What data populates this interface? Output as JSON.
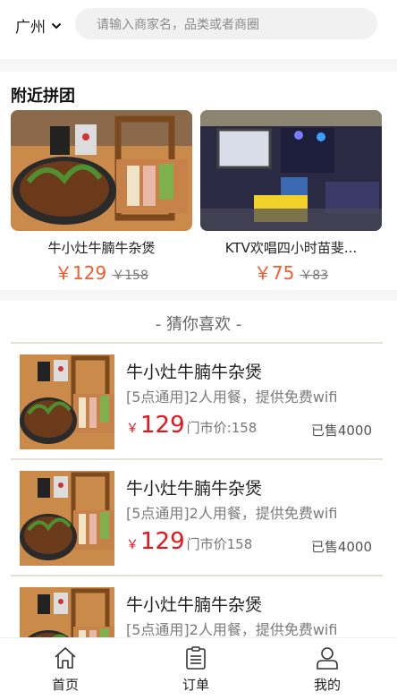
{
  "header": {
    "city": "广州",
    "search_placeholder": "请输入商家名，品类或者商圈"
  },
  "nearby": {
    "title": "附近拼团",
    "deals": [
      {
        "name": "牛小灶牛腩牛杂煲",
        "price": "￥129",
        "old_price": "￥158"
      },
      {
        "name": "KTV欢唱四小时苗斐...",
        "price": "￥75",
        "old_price": "￥83"
      }
    ]
  },
  "guess": {
    "title": "- 猜你喜欢 -",
    "items": [
      {
        "title": "牛小灶牛腩牛杂煲",
        "desc": "[5点通用]2人用餐，提供免费wifi",
        "yen": "￥",
        "price": "129",
        "market": "门市价:158",
        "sold": "已售4000"
      },
      {
        "title": "牛小灶牛腩牛杂煲",
        "desc": "[5点通用]2人用餐，提供免费wifi",
        "yen": "￥",
        "price": "129",
        "market": "门市价158",
        "sold": "已售4000"
      },
      {
        "title": "牛小灶牛腩牛杂煲",
        "desc": "[5点通用]2人用餐，提供免费wifi",
        "yen": "",
        "price": "",
        "market": "",
        "sold": ""
      }
    ]
  },
  "tabbar": {
    "tabs": [
      {
        "label": "首页",
        "icon": "home-icon"
      },
      {
        "label": "订单",
        "icon": "clipboard-icon"
      },
      {
        "label": "我的",
        "icon": "user-icon"
      }
    ]
  },
  "colors": {
    "price_orange": "#f55a2d",
    "price_red": "#e4141b"
  }
}
